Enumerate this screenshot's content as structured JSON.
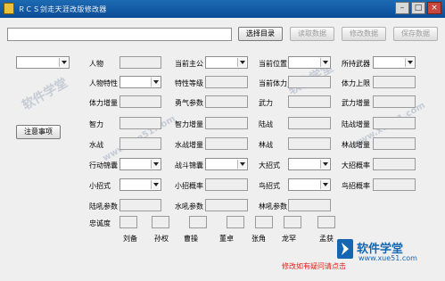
{
  "window": {
    "title": "ＲＣＳ剑走天涯改版修改器",
    "minimize": "–",
    "maximize": "□",
    "close": "×"
  },
  "toolbar": {
    "select_dir": "选择目录",
    "read_data": "读取数据",
    "modify_data": "修改数据",
    "save_data": "保存数据"
  },
  "side": {
    "note_button": "注意事项"
  },
  "fields": {
    "person": "人物",
    "current_lord": "当前主公",
    "current_position": "当前位置",
    "held_weapon": "所持武器",
    "person_trait": "人物特性",
    "trait_level": "特性等级",
    "current_stamina": "当前体力",
    "stamina_max": "体力上限",
    "stamina_gain": "体力增量",
    "bravery_param": "勇气参数",
    "force": "武力",
    "force_gain": "武力增量",
    "wisdom": "智力",
    "wisdom_gain": "智力增量",
    "land_battle": "陆战",
    "land_battle_gain": "陆战增量",
    "water_battle": "水战",
    "water_battle_gain": "水战增量",
    "forest_battle": "林战",
    "forest_battle_gain": "林战增量",
    "action_bag": "行动锦囊",
    "battle_bag": "战斗锦囊",
    "big_move": "大招式",
    "big_move_rate": "大招概率",
    "small_move": "小招式",
    "small_move_rate": "小招概率",
    "bird_move": "鸟招式",
    "bird_move_rate": "鸟招概率",
    "land_roar": "陆吼参数",
    "water_roar": "水吼参数",
    "forest_roar": "林吼参数",
    "loyalty": "忠诚度"
  },
  "loyalty_names": [
    "刘备",
    "孙权",
    "曹操",
    "董卓",
    "张角",
    "龙罕",
    "孟获"
  ],
  "footer": {
    "help_link": "修改如有疑问请点击"
  },
  "watermark": {
    "text": "软件学堂",
    "url": "www.xue51.com"
  },
  "logo": {
    "text": "软件学堂",
    "url": "www.xue51.com"
  },
  "colors": {
    "title_bar": "#0b4c97",
    "help_link": "#e0201b",
    "logo": "#1566b0"
  }
}
